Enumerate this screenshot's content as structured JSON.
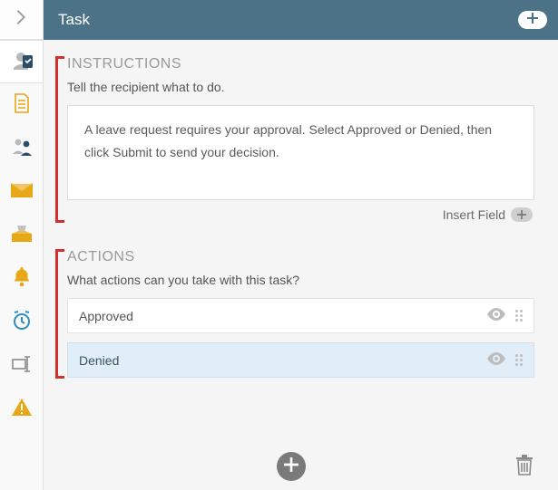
{
  "header": {
    "title": "Task"
  },
  "instructions": {
    "heading": "INSTRUCTIONS",
    "subheading": "Tell the recipient what to do.",
    "body": "A leave request requires your approval. Select Approved or Denied, then click Submit to send your decision.",
    "insert_label": "Insert Field"
  },
  "actions": {
    "heading": "ACTIONS",
    "subheading": "What actions can you take with this task?",
    "items": [
      {
        "label": "Approved",
        "selected": false
      },
      {
        "label": "Denied",
        "selected": true
      }
    ]
  },
  "sidebar_icons": [
    "task-icon",
    "page-icon",
    "people-icon",
    "mail-icon",
    "inbox-icon",
    "bell-icon",
    "clock-icon",
    "cursor-icon",
    "warning-icon"
  ],
  "colors": {
    "header_bg": "#4c7287",
    "accent_orange": "#e6a817",
    "accent_blue": "#4c7287",
    "danger": "#e6a817"
  }
}
